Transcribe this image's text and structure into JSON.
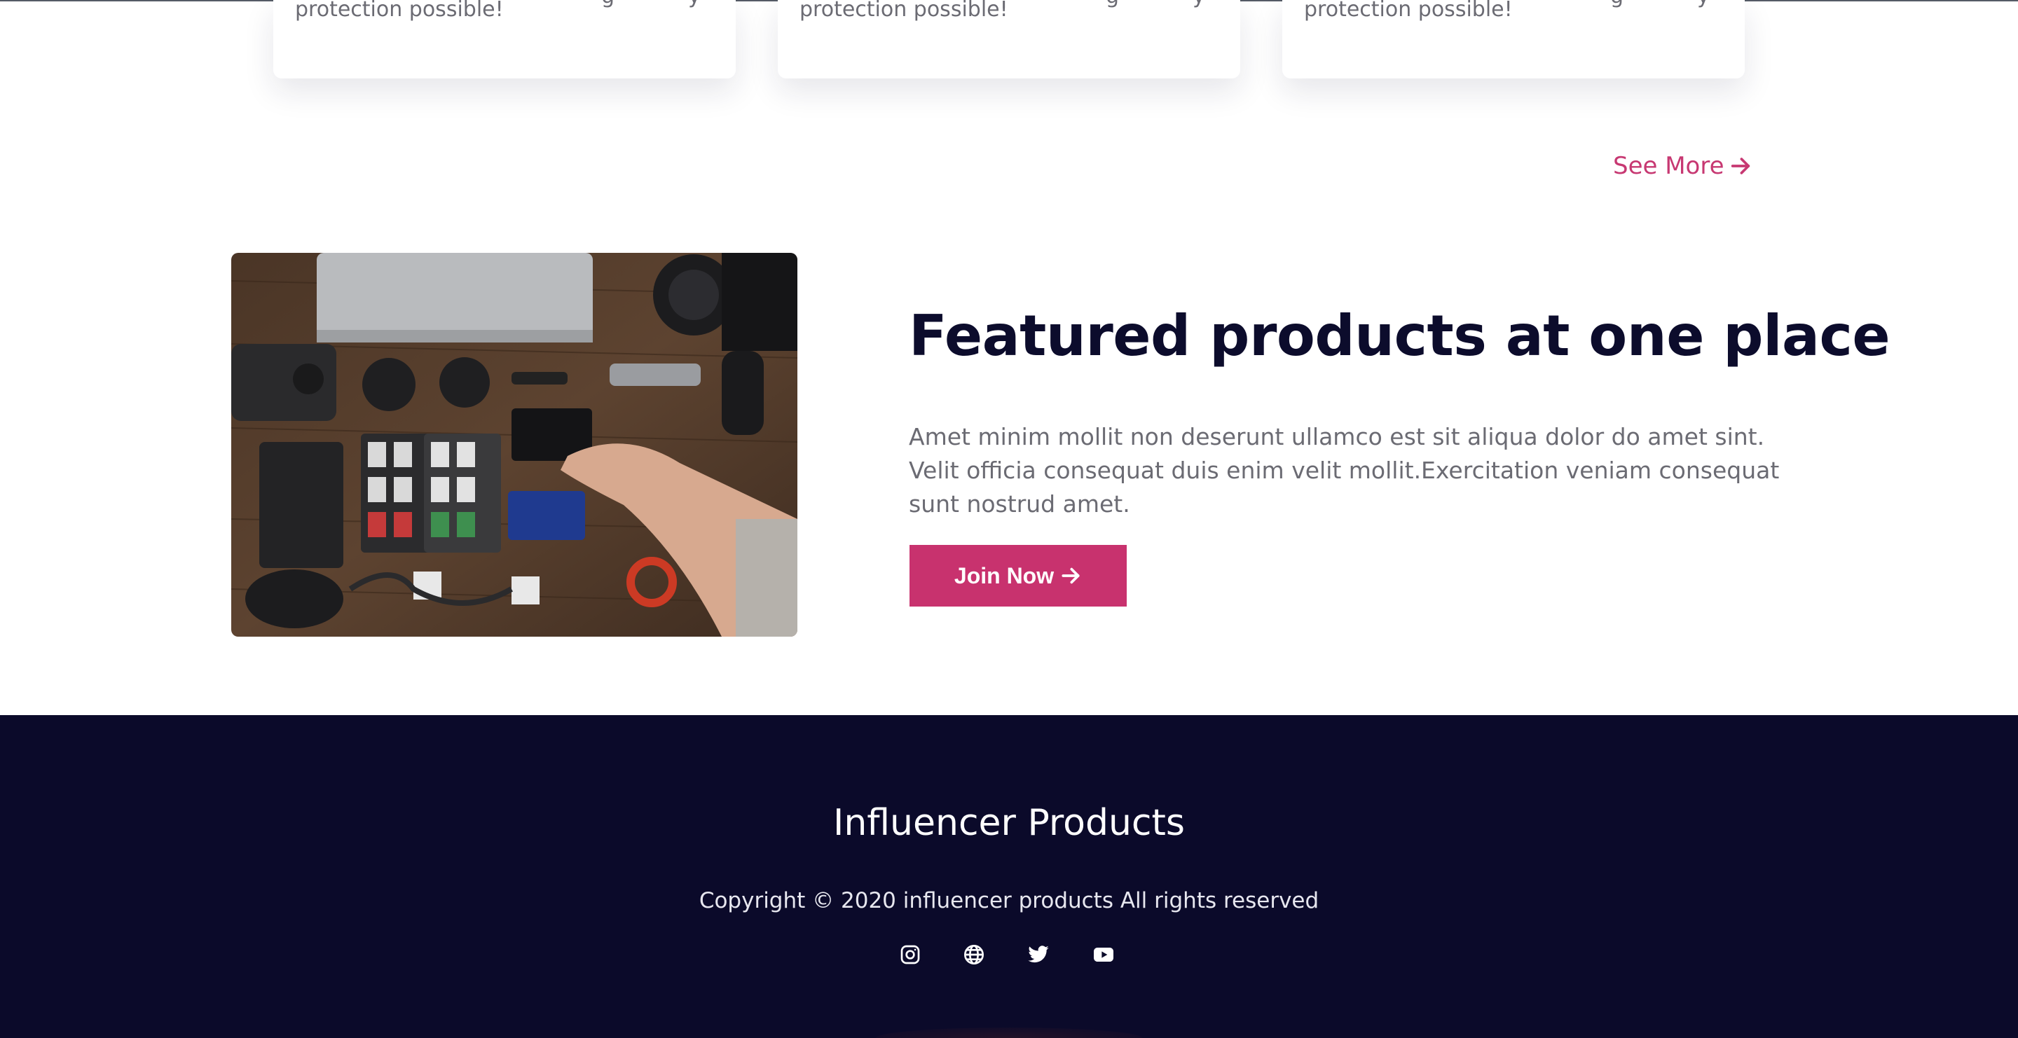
{
  "cards": [
    {
      "text": "protection possible!"
    },
    {
      "text": "protection possible!"
    },
    {
      "text": "protection possible!"
    }
  ],
  "see_more": {
    "label": "See More",
    "icon": "arrow-right-icon",
    "color": "#c73872"
  },
  "feature": {
    "image": "flat-lay-camera-gear-photo",
    "title": "Featured products at one place",
    "description": "Amet minim mollit non deserunt ullamco est sit aliqua dolor do amet sint. Velit officia consequat duis enim velit mollit.Exercitation veniam consequat sunt nostrud amet.",
    "button_label": "Join Now",
    "button_icon": "arrow-right-icon",
    "button_color": "#c8326e"
  },
  "footer": {
    "brand": "Influencer Products",
    "copyright": "Copyright © 2020 influencer products All rights reserved",
    "background": "#0b0a2a",
    "social": [
      {
        "name": "instagram",
        "icon": "instagram-icon"
      },
      {
        "name": "website",
        "icon": "globe-icon"
      },
      {
        "name": "twitter",
        "icon": "twitter-icon"
      },
      {
        "name": "youtube",
        "icon": "youtube-icon"
      }
    ]
  }
}
